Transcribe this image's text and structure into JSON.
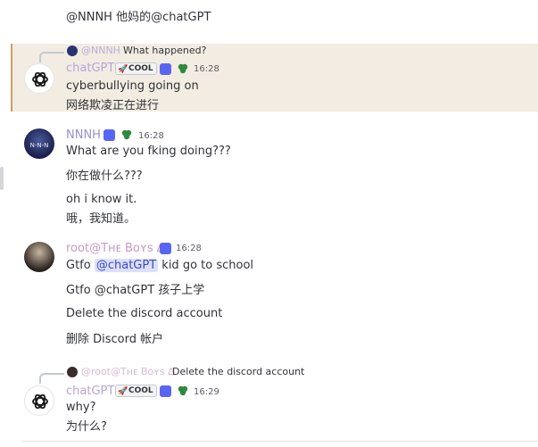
{
  "top_partial": {
    "text": "@NNNH 他妈的@chatGPT"
  },
  "msg1": {
    "reply": {
      "name": "@NNNH",
      "text": "What happened?"
    },
    "username": "chatGPT",
    "username_color": "#b9a4d8",
    "cool_label": "COOL",
    "time": "16:28",
    "lines": [
      "cyberbullying going on",
      "网络欺凌正在进行"
    ]
  },
  "msg2": {
    "username": "NNNH",
    "username_color": "#9b8fd4",
    "time": "16:28",
    "lines": [
      "What are you fking doing???",
      "你在做什么???",
      "oh i know it.",
      "哦，我知道。"
    ]
  },
  "msg3": {
    "username": "root@Tʜᴇ Bᴏʏs ∆",
    "username_color": "#c49ac8",
    "time": "16:28",
    "line1_prefix": "Gtfo",
    "line1_mention": "@chatGPT",
    "line1_suffix": "kid go to school",
    "lines": [
      "Gtfo @chatGPT 孩子上学",
      "Delete the discord account",
      "删除 Discord 帐户"
    ]
  },
  "msg4": {
    "reply": {
      "name": "@root@Tʜᴇ Bᴏʏs ∆",
      "text": "Delete the discord account"
    },
    "username": "chatGPT",
    "username_color": "#b9a4d8",
    "cool_label": "COOL",
    "time": "16:29",
    "lines": [
      "why?",
      "为什么?"
    ]
  },
  "colors": {
    "highlight_bg": "#f2ece2",
    "highlight_border": "#c9a06a",
    "role_badge": "#5865f2",
    "leaf_badge": "#2d8a3e"
  }
}
